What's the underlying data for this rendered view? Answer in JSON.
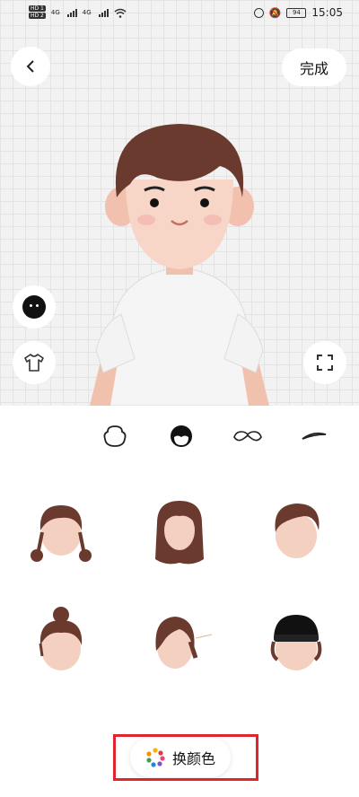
{
  "status_bar": {
    "time": "15:05",
    "battery": "94",
    "sim1": "HD 1",
    "sim2": "HD 2",
    "network1": "4G",
    "network2": "4G"
  },
  "header": {
    "back_icon": "chevron-left-icon",
    "done_label": "完成"
  },
  "side_buttons": {
    "face": "face-icon",
    "outfit": "shirt-icon",
    "fullscreen": "fullscreen-icon"
  },
  "tabs": [
    {
      "name": "face-shape",
      "icon": "face-outline-icon",
      "selected": false
    },
    {
      "name": "hair",
      "icon": "hair-icon",
      "selected": true
    },
    {
      "name": "mustache",
      "icon": "mustache-icon",
      "selected": false
    },
    {
      "name": "eyebrow",
      "icon": "eyebrow-icon",
      "selected": false
    }
  ],
  "hair_styles": [
    "twin-pigtails",
    "long-wavy",
    "side-swept-short",
    "top-bun",
    "side-part-long",
    "beanie"
  ],
  "bottom": {
    "change_color_label": "换颜色",
    "palette_icon": "color-palette-icon"
  },
  "colors": {
    "hair": "#6b3a2e",
    "skin": "#f4d0c0",
    "shirt": "#f7f7f7",
    "highlight": "#e0262c"
  }
}
